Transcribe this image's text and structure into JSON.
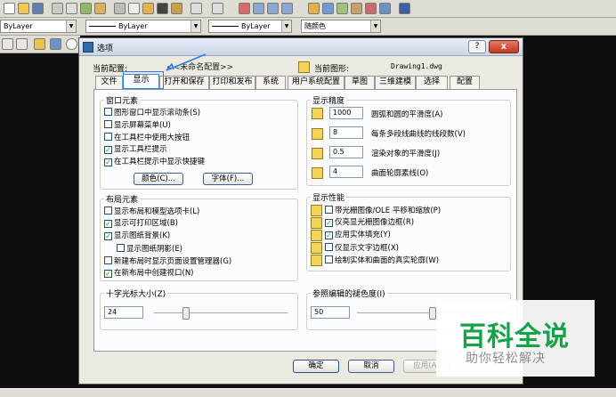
{
  "toolbar": {
    "layer_combo_1": "ByLayer",
    "layer_combo_2": "ByLayer",
    "layer_combo_3": "ByLayer",
    "color_combo": "随颜色"
  },
  "dialog": {
    "title": "选项",
    "help_label": "?",
    "close_label": "x",
    "current_profile_label": "当前配置:",
    "current_profile_value": "<<未命名配置>>",
    "current_drawing_label": "当前图形:",
    "current_drawing_value": "Drawing1.dwg",
    "tabs": [
      "文件",
      "显示",
      "打开和保存",
      "打印和发布",
      "系统",
      "用户系统配置",
      "草图",
      "三维建模",
      "选择",
      "配置"
    ],
    "window_elements": {
      "title": "窗口元素",
      "items": [
        {
          "label": "图形窗口中显示滚动条(S)",
          "checked": false
        },
        {
          "label": "显示屏幕菜单(U)",
          "checked": false
        },
        {
          "label": "在工具栏中使用大按钮",
          "checked": false
        },
        {
          "label": "显示工具栏提示",
          "checked": true
        },
        {
          "label": "在工具栏提示中显示快捷键",
          "checked": true
        }
      ],
      "colors_button": "颜色(C)...",
      "fonts_button": "字体(F)..."
    },
    "display_resolution": {
      "title": "显示精度",
      "rows": [
        {
          "value": "1000",
          "label": "圆弧和圆的平滑度(A)"
        },
        {
          "value": "8",
          "label": "每条多段线曲线的线段数(V)"
        },
        {
          "value": "0.5",
          "label": "渲染对象的平滑度(J)"
        },
        {
          "value": "4",
          "label": "曲面轮廓素线(O)"
        }
      ]
    },
    "layout_elements": {
      "title": "布局元素",
      "items": [
        {
          "label": "显示布局和模型选项卡(L)",
          "checked": false
        },
        {
          "label": "显示可打印区域(B)",
          "checked": true
        },
        {
          "label": "显示图纸背景(K)",
          "checked": true
        },
        {
          "label": "显示图纸阴影(E)",
          "checked": false
        },
        {
          "label": "新建布局时显示页面设置管理器(G)",
          "checked": false
        },
        {
          "label": "在新布局中创建视口(N)",
          "checked": true
        }
      ]
    },
    "display_performance": {
      "title": "显示性能",
      "items": [
        {
          "label": "带光栅图像/OLE 平移和缩放(P)",
          "checked": false
        },
        {
          "label": "仅亮显光栅图像边框(R)",
          "checked": true
        },
        {
          "label": "应用实体填充(Y)",
          "checked": true
        },
        {
          "label": "仅显示文字边框(X)",
          "checked": false
        },
        {
          "label": "绘制实体和曲面的真实轮廓(W)",
          "checked": false
        }
      ]
    },
    "crosshair": {
      "title": "十字光标大小(Z)",
      "value": "24",
      "level": 0.24
    },
    "reference_fade": {
      "title": "参照编辑的褪色度(I)",
      "value": "50",
      "level": 0.5
    },
    "ok_button": "确定",
    "cancel_button": "取消",
    "apply_button": "应用(A)"
  },
  "watermark": {
    "title": "百科全说",
    "subtitle": "助你轻松解决"
  }
}
